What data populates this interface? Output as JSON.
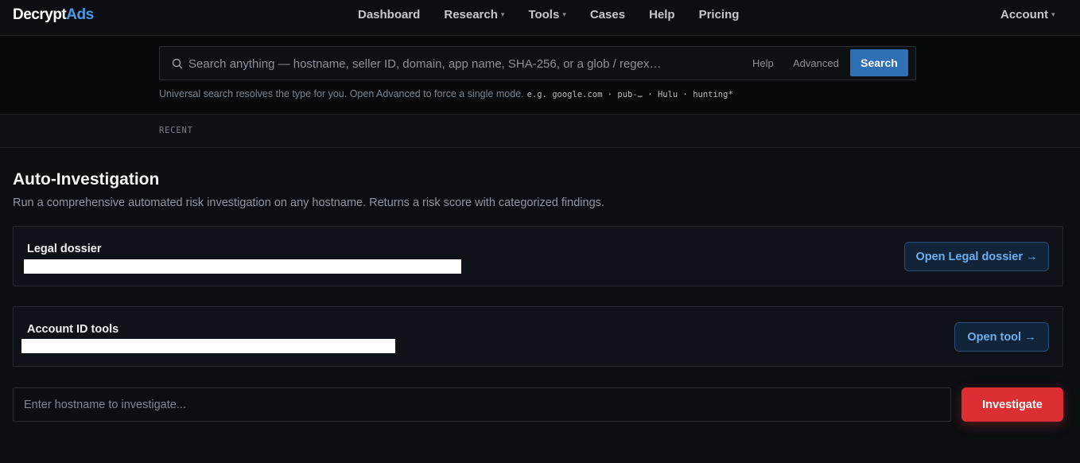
{
  "brand": {
    "part1": "Decrypt",
    "part2": "Ads"
  },
  "nav": {
    "items": [
      {
        "label": "Dashboard",
        "caret": false
      },
      {
        "label": "Research",
        "caret": true
      },
      {
        "label": "Tools",
        "caret": true
      },
      {
        "label": "Cases",
        "caret": false
      },
      {
        "label": "Help",
        "caret": false
      },
      {
        "label": "Pricing",
        "caret": false
      }
    ],
    "account": "Account",
    "caret_glyph": "▾"
  },
  "search": {
    "placeholder": "Search anything — hostname, seller ID, domain, app name, SHA-256, or a glob / regex…",
    "help": "Help",
    "advanced": "Advanced",
    "button": "Search",
    "hint": "Universal search resolves the type for you. Open Advanced to force a single mode.",
    "examples": "e.g. google.com · pub-… · Hulu · hunting*"
  },
  "recent": {
    "label": "RECENT"
  },
  "page": {
    "title": "Auto-Investigation",
    "description": "Run a comprehensive automated risk investigation on any hostname. Returns a risk score with categorized findings."
  },
  "cards": [
    {
      "title": "Legal dossier",
      "button": "Open Legal dossier →"
    },
    {
      "title": "Account ID tools",
      "button": "Open tool →"
    }
  ],
  "investigate": {
    "placeholder": "Enter hostname to investigate...",
    "button": "Investigate"
  },
  "colors": {
    "accent": "#4a9be8",
    "primary_button": "#2f6fb5",
    "danger": "#dc2f33",
    "background": "#0b0e13"
  }
}
